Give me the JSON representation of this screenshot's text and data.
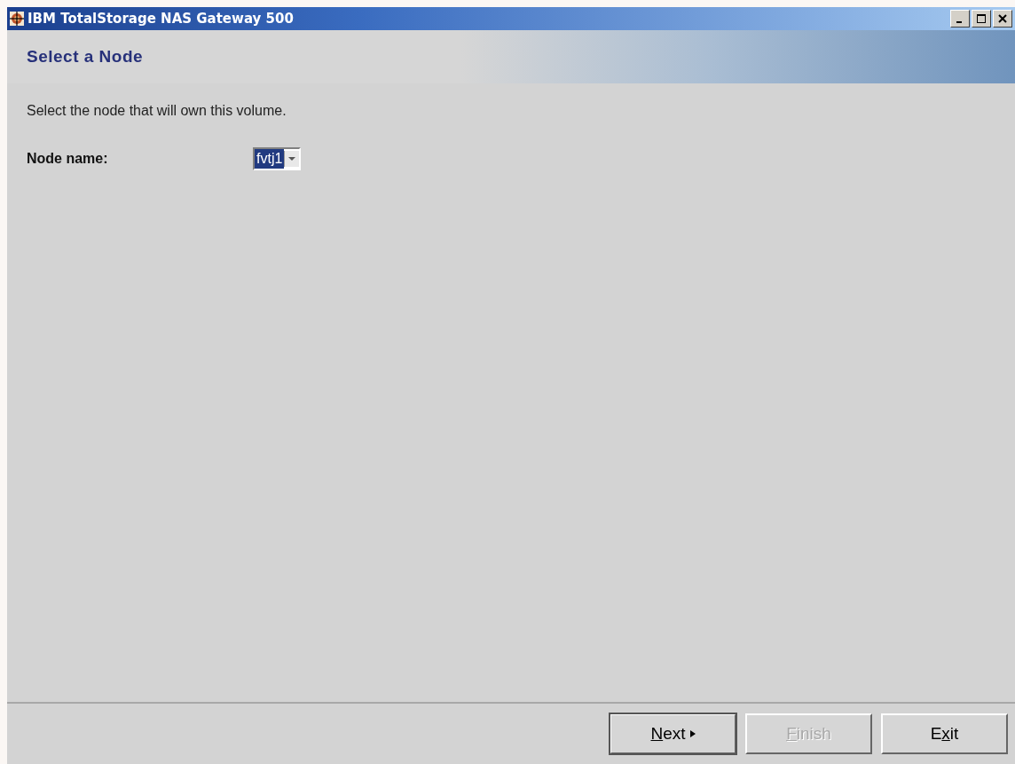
{
  "window": {
    "title": "IBM TotalStorage NAS Gateway 500"
  },
  "header": {
    "title": "Select a Node"
  },
  "instruction": "Select the node that will own this volume.",
  "node_field": {
    "label": "Node name:",
    "value": "fvtj1"
  },
  "buttons": [
    {
      "mnemonic": "N",
      "after": "ext",
      "kind": "next",
      "disabled": false,
      "default": true
    },
    {
      "mnemonic": "F",
      "after": "inish",
      "kind": "plain",
      "disabled": true,
      "default": false
    },
    {
      "before": "E",
      "mnemonic": "x",
      "after": "it",
      "kind": "plain",
      "disabled": false,
      "default": false
    }
  ]
}
